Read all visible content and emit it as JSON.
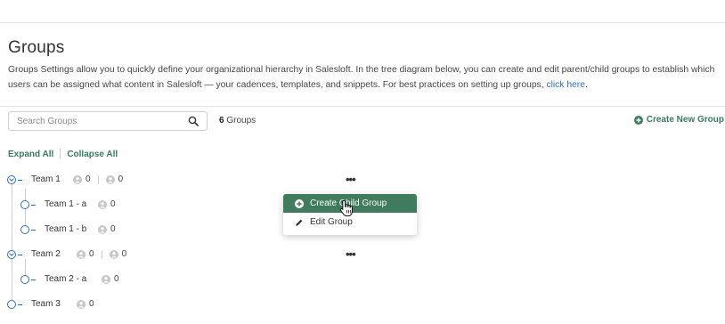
{
  "page": {
    "title": "Groups",
    "description": "Groups Settings allow you to quickly define your organizational hierarchy in Salesloft. In the tree diagram below, you can create and edit parent/child groups to establish which users can be assigned what content in Salesloft — your cadences, templates, and snippets. For best practices on setting up groups, ",
    "description_link": "click here",
    "description_end": "."
  },
  "toolbar": {
    "search_placeholder": "Search Groups",
    "group_count_number": "6",
    "group_count_label": " Groups",
    "create_new_label": "Create New Group",
    "expand_all": "Expand All",
    "collapse_all": "Collapse All"
  },
  "tree": [
    {
      "label": "Team 1",
      "users": "0",
      "children_count": "0",
      "has_children": true
    },
    {
      "label": "Team 1 - a",
      "users": "0",
      "child": true
    },
    {
      "label": "Team 1 - b",
      "users": "0",
      "child": true
    },
    {
      "label": "Team 2",
      "users": "0",
      "children_count": "0",
      "has_children": true
    },
    {
      "label": "Team 2 - a",
      "users": "0",
      "child": true
    },
    {
      "label": "Team 3",
      "users": "0",
      "has_children": false
    }
  ],
  "more_icon": "•••",
  "context_menu": {
    "items": [
      {
        "label": "Create Child Group",
        "icon": "plus-circle-icon",
        "active": true
      },
      {
        "label": "Edit Group",
        "icon": "pencil-icon",
        "active": false
      }
    ]
  },
  "colors": {
    "accent_green": "#407b5e",
    "link_blue": "#2f6fb0"
  }
}
